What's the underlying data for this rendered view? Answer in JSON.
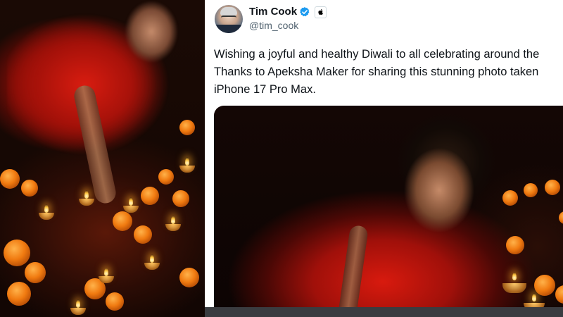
{
  "tweet": {
    "author_name": "Tim Cook",
    "handle": "@tim_cook",
    "affiliate_badge": "",
    "text": "Wishing a joyful and healthy Diwali to all celebrating around the\nThanks to Apeksha Maker for sharing this stunning photo taken\niPhone 17 Pro Max."
  },
  "colors": {
    "verified_blue": "#1d9bf0",
    "name_text": "#0f1419",
    "handle_text": "#536471"
  },
  "icons": {
    "verified": "verified-badge-icon",
    "affiliate": "apple-logo-icon"
  }
}
